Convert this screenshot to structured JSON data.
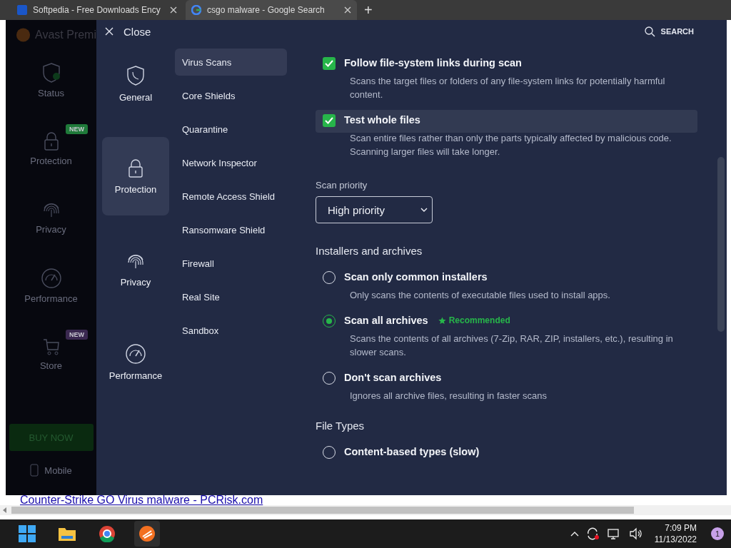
{
  "browser": {
    "tabs": [
      {
        "title": "Softpedia - Free Downloads Ency",
        "selected": false
      },
      {
        "title": "csgo malware - Google Search",
        "selected": true
      }
    ],
    "new_tab": "+",
    "page_link": "Counter-Strike GO Virus malware - PCRisk.com"
  },
  "app_background": {
    "title": "Avast Premi",
    "nav": [
      {
        "label": "Status"
      },
      {
        "label": "Protection",
        "badge": "NEW",
        "color": "#1f7a3a"
      },
      {
        "label": "Privacy"
      },
      {
        "label": "Performance"
      },
      {
        "label": "Store",
        "badge": "NEW",
        "color": "#3a2850"
      }
    ],
    "buy_button": "BUY NOW",
    "mobile": "Mobile"
  },
  "settings": {
    "close": "Close",
    "search": "SEARCH",
    "categories": [
      {
        "label": "General",
        "selected": false
      },
      {
        "label": "Protection",
        "selected": true
      },
      {
        "label": "Privacy",
        "selected": false
      },
      {
        "label": "Performance",
        "selected": false
      }
    ],
    "subnav": [
      {
        "label": "Virus Scans",
        "selected": true
      },
      {
        "label": "Core Shields",
        "selected": false
      },
      {
        "label": "Quarantine",
        "selected": false
      },
      {
        "label": "Network Inspector",
        "selected": false
      },
      {
        "label": "Remote Access Shield",
        "selected": false
      },
      {
        "label": "Ransomware Shield",
        "selected": false
      },
      {
        "label": "Firewall",
        "selected": false
      },
      {
        "label": "Real Site",
        "selected": false
      },
      {
        "label": "Sandbox",
        "selected": false
      }
    ],
    "options": [
      {
        "kind": "checkbox",
        "label": "Follow file-system links during scan",
        "checked": true,
        "highlighted": false,
        "description": "Scans the target files or folders of any file-system links for potentially harmful content."
      },
      {
        "kind": "checkbox",
        "label": "Test whole files",
        "checked": true,
        "highlighted": true,
        "description": "Scan entire files rather than only the parts typically affected by malicious code. Scanning larger files will take longer."
      },
      {
        "kind": "select",
        "label": "Scan priority",
        "value": "High priority"
      },
      {
        "kind": "heading",
        "label": "Installers and archives"
      },
      {
        "kind": "radio",
        "label": "Scan only common installers",
        "selected": false,
        "description": "Only scans the contents of executable files used to install apps."
      },
      {
        "kind": "radio",
        "label": "Scan all archives",
        "selected": true,
        "badge": "Recommended",
        "description": "Scans the contents of all archives (7-Zip, RAR, ZIP, installers, etc.), resulting in slower scans."
      },
      {
        "kind": "radio",
        "label": "Don't scan archives",
        "selected": false,
        "description": "Ignores all archive files, resulting in faster scans"
      },
      {
        "kind": "heading",
        "label": "File Types"
      },
      {
        "kind": "radio",
        "label": "Content-based types (slow)",
        "selected": false
      }
    ]
  },
  "taskbar": {
    "time": "7:09 PM",
    "date": "11/13/2022",
    "notifications": "1"
  }
}
